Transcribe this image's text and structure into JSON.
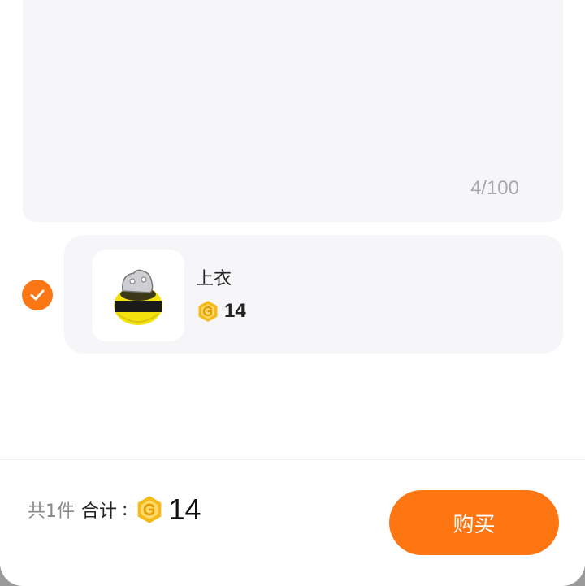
{
  "note": {
    "counter": "4/100"
  },
  "item": {
    "selected": true,
    "name": "上衣",
    "price": "14",
    "thumbnail_icon": "bee-outfit-icon",
    "currency_icon": "coin-icon"
  },
  "footer": {
    "quantity_text": "共1件",
    "total_label": "合计",
    "total_colon": ":",
    "total_amount": "14",
    "buy_label": "购买"
  },
  "colors": {
    "accent": "#fd7612",
    "coin": "#f5b91a",
    "card_bg": "#f6f6f8"
  }
}
